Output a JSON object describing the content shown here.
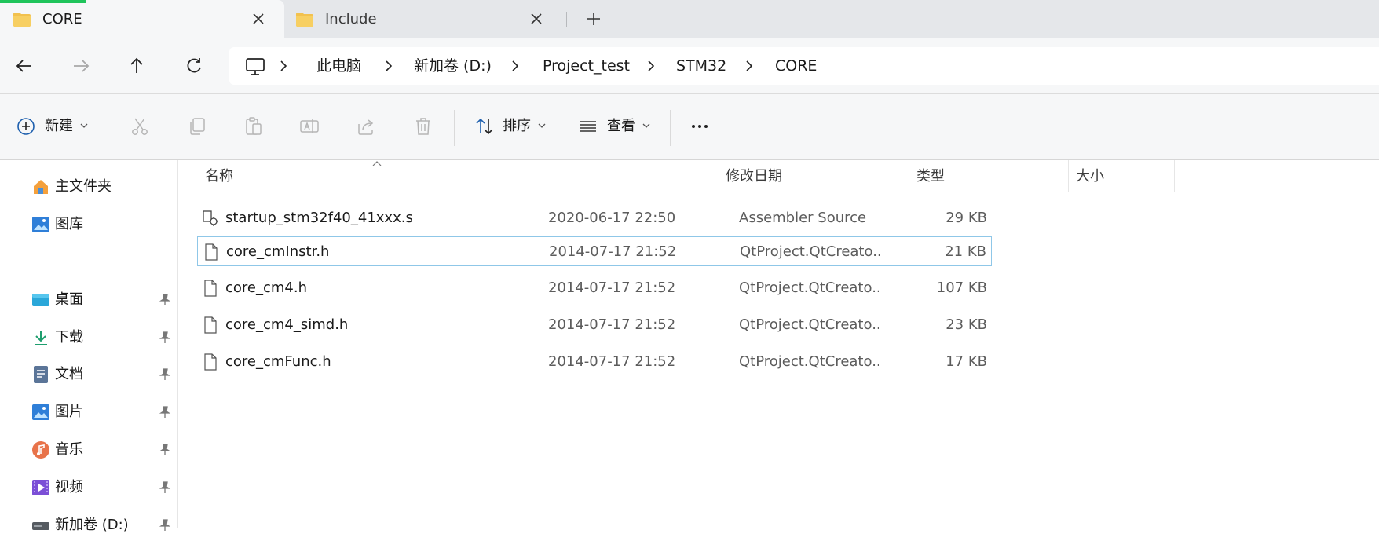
{
  "tabs": [
    {
      "label": "CORE",
      "icon": "folder-icon",
      "active": true
    },
    {
      "label": "Include",
      "icon": "folder-icon",
      "active": false
    }
  ],
  "colors": {
    "accent": "#1fc45b",
    "folder": "#f2c14e",
    "selection_border": "#8fc7e8"
  },
  "breadcrumbs": [
    "此电脑",
    "新加卷 (D:)",
    "Project_test",
    "STM32",
    "CORE"
  ],
  "toolbar": {
    "new_label": "新建",
    "sort_label": "排序",
    "view_label": "查看"
  },
  "sidebar": {
    "top_items": [
      {
        "label": "主文件夹",
        "icon": "home-icon"
      },
      {
        "label": "图库",
        "icon": "gallery-icon"
      }
    ],
    "pinned_items": [
      {
        "label": "桌面",
        "icon": "desktop-icon"
      },
      {
        "label": "下载",
        "icon": "download-icon"
      },
      {
        "label": "文档",
        "icon": "documents-icon"
      },
      {
        "label": "图片",
        "icon": "pictures-icon"
      },
      {
        "label": "音乐",
        "icon": "music-icon"
      },
      {
        "label": "视频",
        "icon": "videos-icon"
      },
      {
        "label": "新加卷 (D:)",
        "icon": "drive-icon"
      }
    ]
  },
  "columns": {
    "name": "名称",
    "date": "修改日期",
    "type": "类型",
    "size": "大小"
  },
  "files": [
    {
      "name": "startup_stm32f40_41xxx.s",
      "date": "2020-06-17 22:50",
      "type": "Assembler Source",
      "size": "29 KB",
      "icon": "assembler-file-icon"
    },
    {
      "name": "core_cmInstr.h",
      "date": "2014-07-17 21:52",
      "type": "QtProject.QtCreato...",
      "size": "21 KB",
      "icon": "file-icon",
      "selected": true
    },
    {
      "name": "core_cm4.h",
      "date": "2014-07-17 21:52",
      "type": "QtProject.QtCreato...",
      "size": "107 KB",
      "icon": "file-icon"
    },
    {
      "name": "core_cm4_simd.h",
      "date": "2014-07-17 21:52",
      "type": "QtProject.QtCreato...",
      "size": "23 KB",
      "icon": "file-icon"
    },
    {
      "name": "core_cmFunc.h",
      "date": "2014-07-17 21:52",
      "type": "QtProject.QtCreato...",
      "size": "17 KB",
      "icon": "file-icon"
    }
  ]
}
